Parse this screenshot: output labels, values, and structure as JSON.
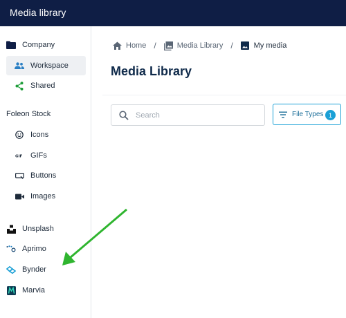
{
  "app": {
    "title": "Media library"
  },
  "sidebar": {
    "items": [
      {
        "label": "Company",
        "icon": "folder-icon"
      },
      {
        "label": "Workspace",
        "icon": "people-icon",
        "active": true
      },
      {
        "label": "Shared",
        "icon": "share-icon"
      }
    ],
    "stock_heading": "Foleon Stock",
    "stock_items": [
      {
        "label": "Icons",
        "icon": "smiley-icon"
      },
      {
        "label": "GIFs",
        "icon": "gif-icon"
      },
      {
        "label": "Buttons",
        "icon": "button-icon"
      },
      {
        "label": "Images",
        "icon": "camera-icon"
      }
    ],
    "integrations": [
      {
        "label": "Unsplash",
        "icon": "unsplash-icon"
      },
      {
        "label": "Aprimo",
        "icon": "aprimo-icon"
      },
      {
        "label": "Bynder",
        "icon": "bynder-icon"
      },
      {
        "label": "Marvia",
        "icon": "marvia-icon"
      }
    ]
  },
  "breadcrumb": [
    {
      "label": "Home",
      "icon": "home-icon"
    },
    {
      "label": "Media Library",
      "icon": "gallery-icon"
    },
    {
      "label": "My media",
      "icon": "image-icon"
    }
  ],
  "breadcrumb_separator": "/",
  "page": {
    "title": "Media Library"
  },
  "search": {
    "placeholder": "Search",
    "value": ""
  },
  "filter": {
    "label": "File Types",
    "count": "1"
  },
  "colors": {
    "topbar": "#0f1e45",
    "accent": "#1aa0d6",
    "annotation_arrow": "#2fb52f",
    "active_bg": "#eef0f3"
  }
}
